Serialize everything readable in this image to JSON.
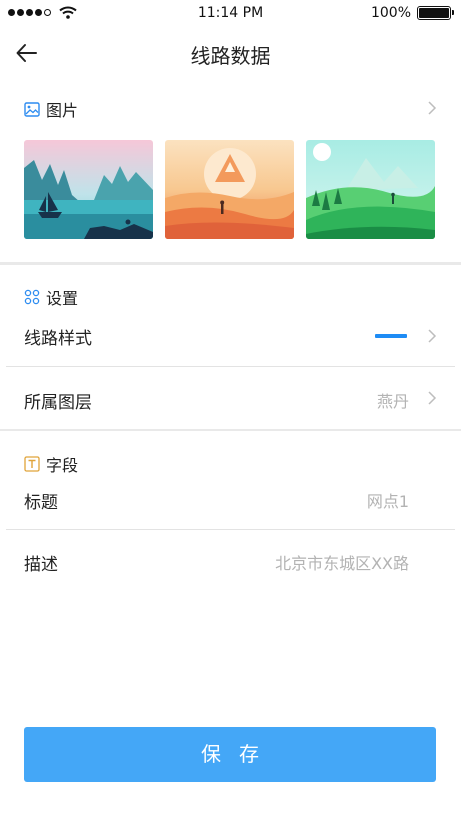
{
  "status_bar": {
    "time": "11:14 PM",
    "battery": "100%"
  },
  "nav": {
    "title": "线路数据"
  },
  "pictures": {
    "heading": "图片",
    "thumbnails": [
      "lake-sailboat-landscape",
      "desert-sunset-pyramid",
      "green-hills-hiker"
    ]
  },
  "settings": {
    "heading": "设置",
    "line_style_label": "线路样式",
    "line_style_color": "#1e8cf5",
    "layer_label": "所属图层",
    "layer_value": "燕丹"
  },
  "fields": {
    "heading": "字段",
    "title_label": "标题",
    "title_value": "网点1",
    "desc_label": "描述",
    "desc_value": "北京市东城区XX路"
  },
  "save_label": "保存",
  "colors": {
    "accent": "#1e8cf5",
    "save_button": "#44a7f7"
  }
}
